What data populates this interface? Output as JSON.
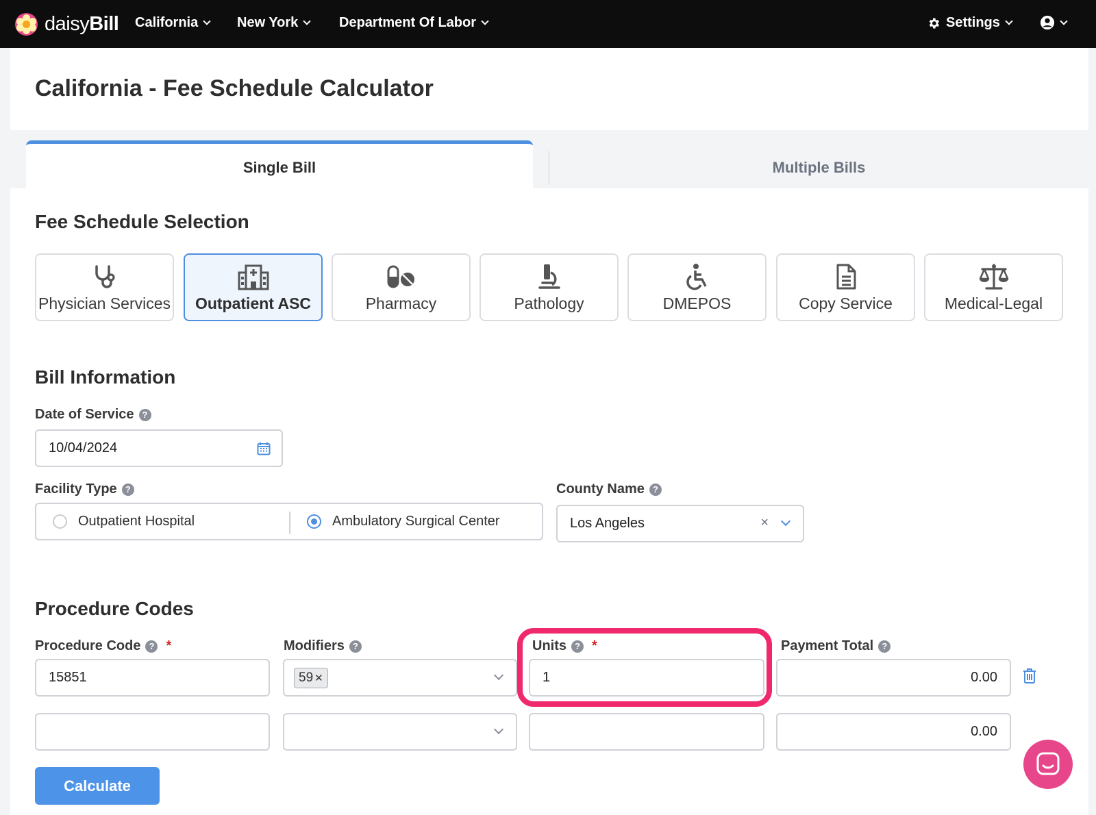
{
  "nav": {
    "brand_prefix": "daisy",
    "brand_suffix": "Bill",
    "items": [
      {
        "label": "California"
      },
      {
        "label": "New York"
      },
      {
        "label": "Department Of Labor"
      }
    ],
    "settings_label": "Settings"
  },
  "page": {
    "title": "California - Fee Schedule Calculator"
  },
  "tabs": [
    {
      "label": "Single Bill",
      "active": true
    },
    {
      "label": "Multiple Bills",
      "active": false
    }
  ],
  "fee_schedule": {
    "title": "Fee Schedule Selection",
    "options": [
      {
        "label": "Physician Services",
        "icon": "stethoscope-icon",
        "active": false
      },
      {
        "label": "Outpatient ASC",
        "icon": "hospital-icon",
        "active": true
      },
      {
        "label": "Pharmacy",
        "icon": "pills-icon",
        "active": false
      },
      {
        "label": "Pathology",
        "icon": "microscope-icon",
        "active": false
      },
      {
        "label": "DMEPOS",
        "icon": "wheelchair-icon",
        "active": false
      },
      {
        "label": "Copy Service",
        "icon": "document-icon",
        "active": false
      },
      {
        "label": "Medical-Legal",
        "icon": "scale-icon",
        "active": false
      }
    ]
  },
  "bill_info": {
    "title": "Bill Information",
    "date_label": "Date of Service",
    "date_value": "10/04/2024",
    "facility_label": "Facility Type",
    "facility_options": [
      {
        "label": "Outpatient Hospital",
        "selected": false
      },
      {
        "label": "Ambulatory Surgical Center",
        "selected": true
      }
    ],
    "county_label": "County Name",
    "county_value": "Los Angeles"
  },
  "procedure": {
    "title": "Procedure Codes",
    "headers": {
      "code": "Procedure Code",
      "modifiers": "Modifiers",
      "units": "Units",
      "payment": "Payment Total"
    },
    "required_mark": "*",
    "rows": [
      {
        "code": "15851",
        "modifiers": [
          "59"
        ],
        "units": "1",
        "payment": "0.00"
      },
      {
        "code": "",
        "modifiers": [],
        "units": "",
        "payment": "0.00"
      }
    ],
    "calculate_label": "Calculate"
  },
  "colors": {
    "accent": "#4d8fe0",
    "highlight": "#f0286e",
    "brand_pink": "#e8468a",
    "nav_bg": "#0d0d0d"
  }
}
